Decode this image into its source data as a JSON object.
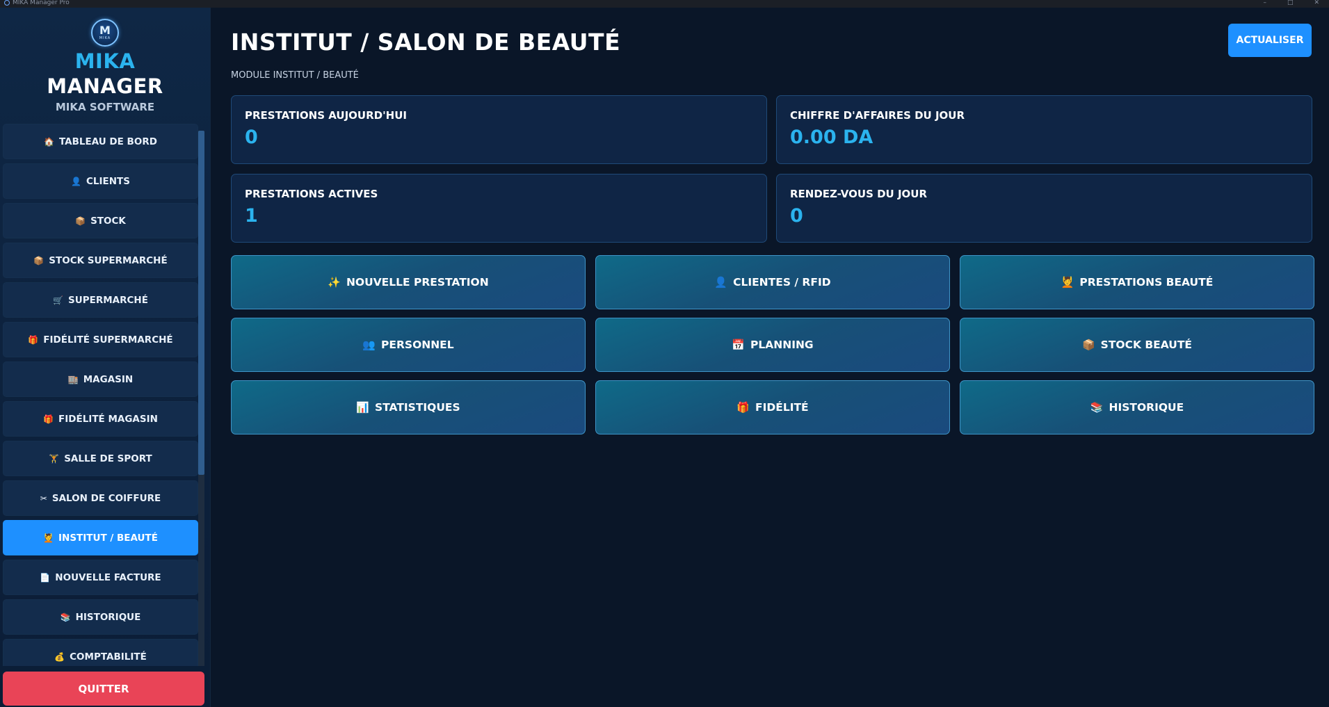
{
  "window": {
    "title": "MIKA Manager Pro",
    "controls": [
      "–",
      "□",
      "✕"
    ]
  },
  "brand": {
    "logo_letters": "M",
    "logo_caption": "MIKA",
    "name_line1": "MIKA",
    "name_line2": "MANAGER",
    "subtitle": "MIKA SOFTWARE"
  },
  "sidebar": {
    "items": [
      {
        "icon": "🏠",
        "icon_name": "house-icon",
        "label": "TABLEAU DE BORD",
        "active": false
      },
      {
        "icon": "👤",
        "icon_name": "user-icon",
        "label": "CLIENTS",
        "active": false
      },
      {
        "icon": "📦",
        "icon_name": "box-icon",
        "label": "STOCK",
        "active": false
      },
      {
        "icon": "📦",
        "icon_name": "box-icon",
        "label": "STOCK SUPERMARCHÉ",
        "active": false
      },
      {
        "icon": "🛒",
        "icon_name": "cart-icon",
        "label": "SUPERMARCHÉ",
        "active": false
      },
      {
        "icon": "🎁",
        "icon_name": "gift-icon",
        "label": "FIDÉLITÉ SUPERMARCHÉ",
        "active": false
      },
      {
        "icon": "🏬",
        "icon_name": "store-icon",
        "label": "MAGASIN",
        "active": false
      },
      {
        "icon": "🎁",
        "icon_name": "gift-icon",
        "label": "FIDÉLITÉ MAGASIN",
        "active": false
      },
      {
        "icon": "🏋",
        "icon_name": "dumbbell-icon",
        "label": "SALLE DE SPORT",
        "active": false
      },
      {
        "icon": "✂",
        "icon_name": "scissors-icon",
        "label": "SALON DE COIFFURE",
        "active": false
      },
      {
        "icon": "💆",
        "icon_name": "beauty-icon",
        "label": "INSTITUT / BEAUTÉ",
        "active": true
      },
      {
        "icon": "📄",
        "icon_name": "document-icon",
        "label": "NOUVELLE FACTURE",
        "active": false
      },
      {
        "icon": "📚",
        "icon_name": "books-icon",
        "label": "HISTORIQUE",
        "active": false
      },
      {
        "icon": "💰",
        "icon_name": "money-icon",
        "label": "COMPTABILITÉ",
        "active": false
      }
    ],
    "quit_label": "QUITTER"
  },
  "header": {
    "title": "INSTITUT / SALON DE BEAUTÉ",
    "refresh_label": "ACTUALISER",
    "subtitle": "MODULE INSTITUT / BEAUTÉ"
  },
  "stats": [
    {
      "label": "PRESTATIONS AUJOURD'HUI",
      "value": "0"
    },
    {
      "label": "CHIFFRE D'AFFAIRES DU JOUR",
      "value": "0.00 DA"
    },
    {
      "label": "PRESTATIONS ACTIVES",
      "value": "1"
    },
    {
      "label": "RENDEZ-VOUS DU JOUR",
      "value": "0"
    }
  ],
  "tiles": [
    {
      "icon": "✨",
      "icon_name": "sparkles-icon",
      "label": "NOUVELLE PRESTATION"
    },
    {
      "icon": "👤",
      "icon_name": "user-icon",
      "label": "CLIENTES / RFID"
    },
    {
      "icon": "💆",
      "icon_name": "beauty-icon",
      "label": "PRESTATIONS BEAUTÉ"
    },
    {
      "icon": "👥",
      "icon_name": "group-icon",
      "label": "PERSONNEL"
    },
    {
      "icon": "📅",
      "icon_name": "calendar-icon",
      "label": "PLANNING"
    },
    {
      "icon": "📦",
      "icon_name": "box-icon",
      "label": "STOCK BEAUTÉ"
    },
    {
      "icon": "📊",
      "icon_name": "chart-icon",
      "label": "STATISTIQUES"
    },
    {
      "icon": "🎁",
      "icon_name": "gift-icon",
      "label": "FIDÉLITÉ"
    },
    {
      "icon": "📚",
      "icon_name": "books-icon",
      "label": "HISTORIQUE"
    }
  ]
}
